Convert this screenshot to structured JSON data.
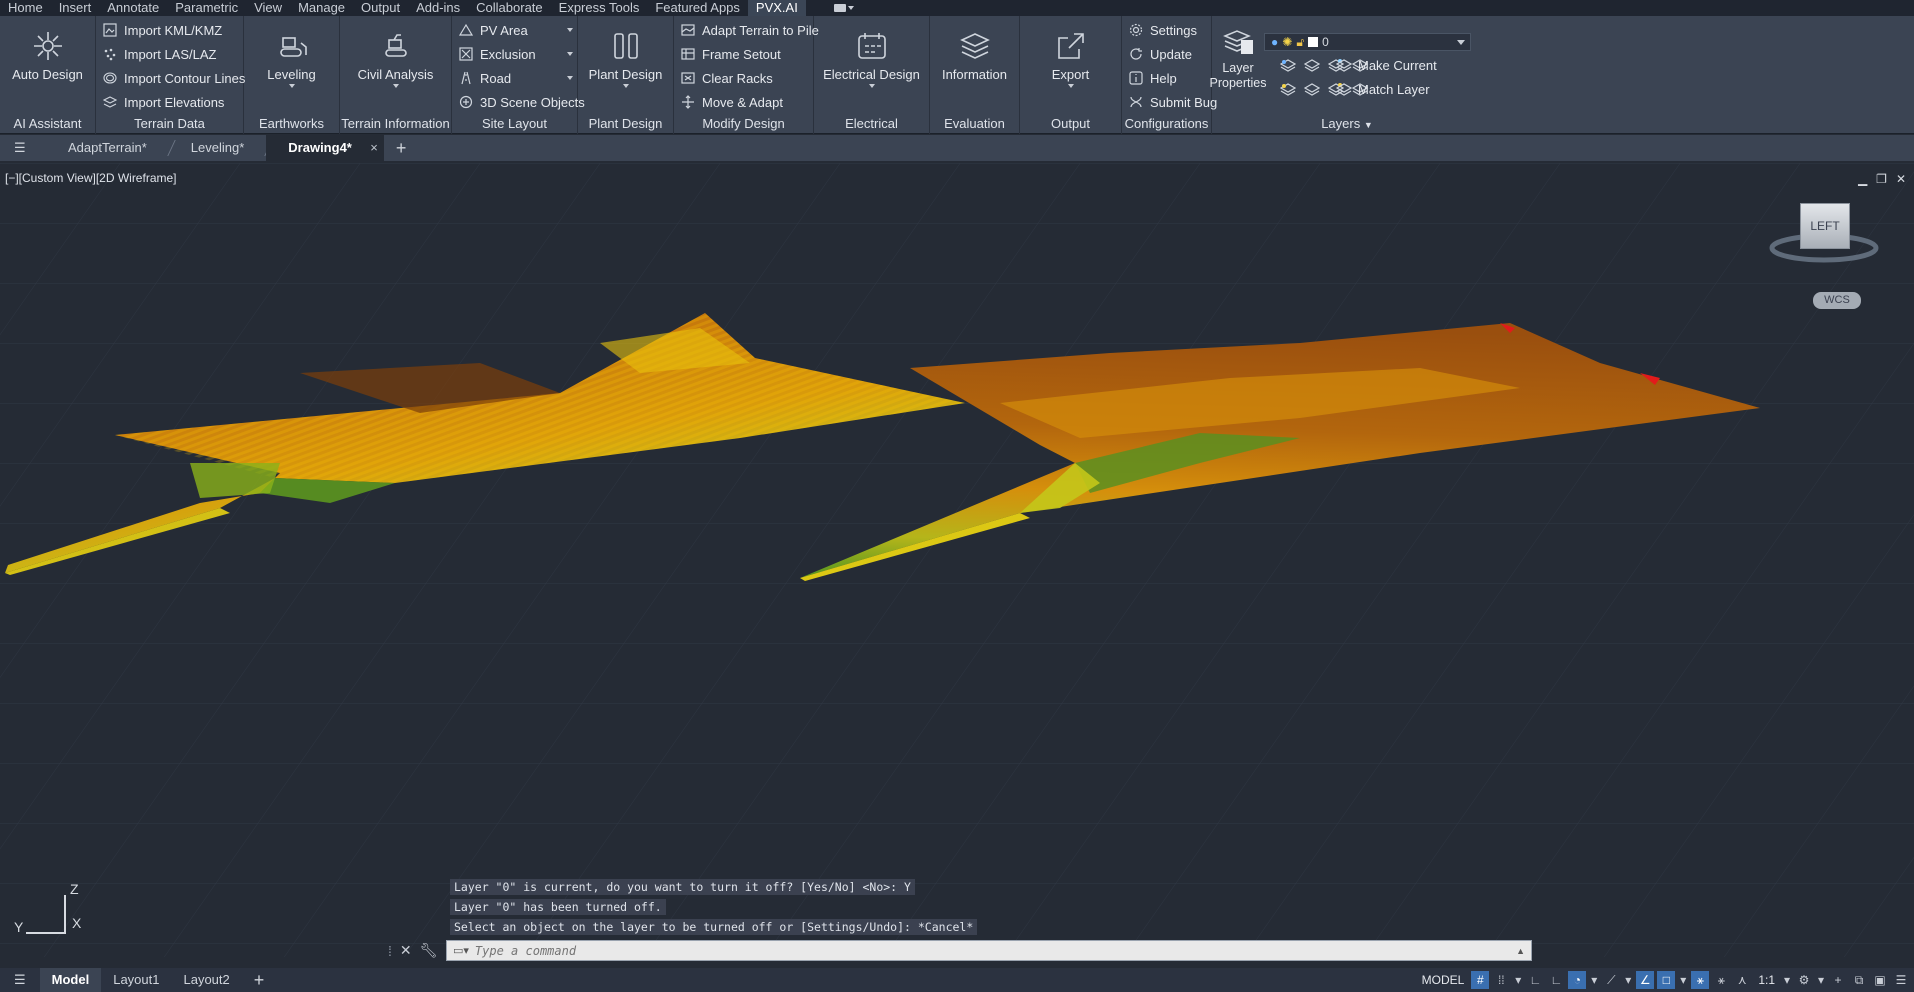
{
  "menubar": {
    "items": [
      "Home",
      "Insert",
      "Annotate",
      "Parametric",
      "View",
      "Manage",
      "Output",
      "Add-ins",
      "Collaborate",
      "Express Tools",
      "Featured Apps",
      "PVX.AI"
    ],
    "active": "PVX.AI"
  },
  "ribbon": {
    "ai_assistant": {
      "title": "AI Assistant",
      "auto_design": "Auto Design"
    },
    "terrain_data": {
      "title": "Terrain Data",
      "items": [
        "Import KML/KMZ",
        "Import LAS/LAZ",
        "Import Contour Lines",
        "Import Elevations"
      ]
    },
    "earthworks": {
      "title": "Earthworks",
      "leveling": "Leveling"
    },
    "terrain_information": {
      "title": "Terrain Information",
      "civil_analysis": "Civil Analysis"
    },
    "site_layout": {
      "title": "Site Layout",
      "items": [
        "PV Area",
        "Exclusion",
        "Road",
        "3D Scene Objects"
      ]
    },
    "plant_design": {
      "title": "Plant Design",
      "button": "Plant Design"
    },
    "modify_design": {
      "title": "Modify Design",
      "items": [
        "Adapt Terrain to Pile",
        "Frame Setout",
        "Clear Racks",
        "Move & Adapt"
      ]
    },
    "electrical": {
      "title": "Electrical",
      "button": "Electrical Design"
    },
    "evaluation": {
      "title": "Evaluation",
      "button": "Information"
    },
    "output": {
      "title": "Output",
      "button": "Export"
    },
    "configurations": {
      "title": "Configurations",
      "items": [
        "Settings",
        "Update",
        "Help",
        "Submit Bug"
      ]
    },
    "layers": {
      "title": "Layers",
      "layer_properties": "Layer Properties",
      "current_layer": "0",
      "make_current": "Make Current",
      "match_layer": "Match Layer"
    }
  },
  "doctabs": {
    "tabs": [
      "AdaptTerrain*",
      "Leveling*",
      "Drawing4*"
    ],
    "active": "Drawing4*",
    "close": "×",
    "add": "+"
  },
  "viewport": {
    "label": "[−][Custom View][2D Wireframe]",
    "viewcube_face": "LEFT",
    "wcs": "WCS",
    "ucs": {
      "z": "Z",
      "y": "Y",
      "x": "X"
    }
  },
  "command": {
    "history": [
      "Layer \"0\" is current, do you want to turn it off? [Yes/No] <No>: Y",
      "Layer \"0\" has been turned off.",
      "Select an object on the layer to be turned off or [Settings/Undo]: *Cancel*"
    ],
    "placeholder": "Type a command"
  },
  "statusbar": {
    "layout_tabs": [
      "Model",
      "Layout1",
      "Layout2"
    ],
    "active_layout": "Model",
    "model_label": "MODEL",
    "scale": "1:1"
  },
  "colors": {
    "background": "#252b35",
    "ribbon": "#3b4453",
    "accent": "#3a6fb0",
    "terrain_high": "#8b4a0c",
    "terrain_mid": "#d98a0a",
    "terrain_yellow": "#e8d20d",
    "terrain_low": "#6aa51e"
  }
}
